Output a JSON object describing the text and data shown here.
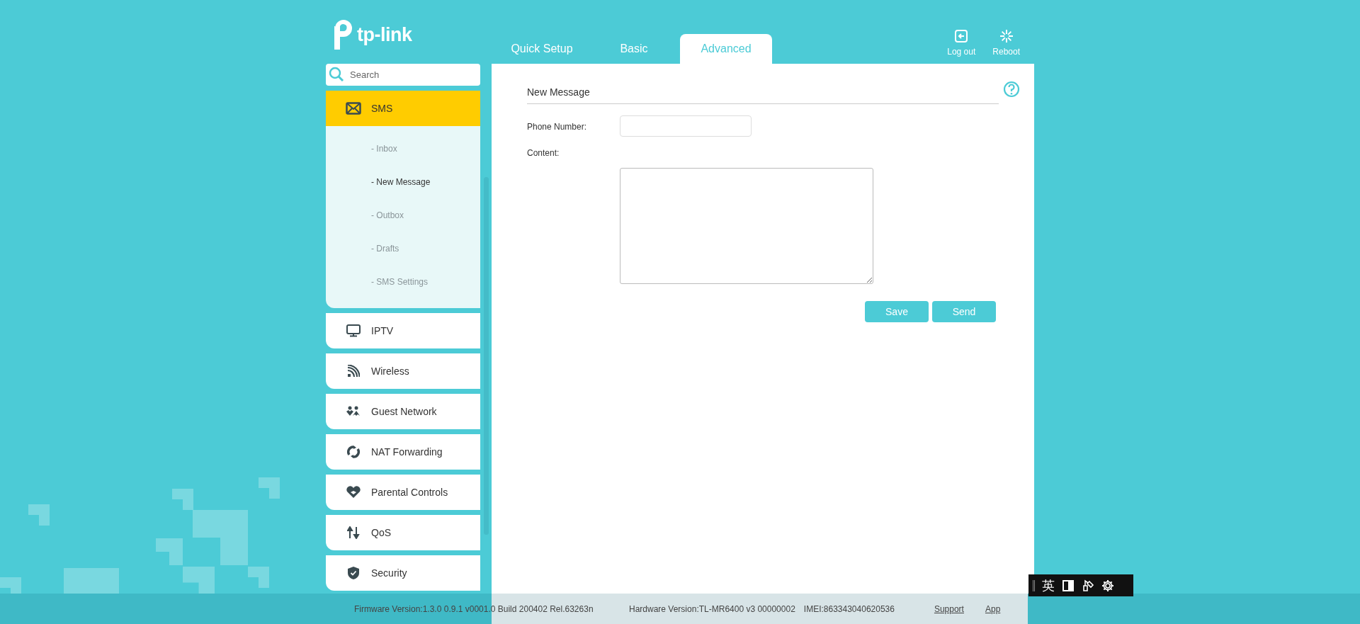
{
  "logo": {
    "text": "tp-link"
  },
  "tabs": [
    {
      "label": "Quick Setup",
      "selected": false
    },
    {
      "label": "Basic",
      "selected": false
    },
    {
      "label": "Advanced",
      "selected": true
    }
  ],
  "header_actions": [
    {
      "label": "Log out"
    },
    {
      "label": "Reboot"
    }
  ],
  "sidebar": {
    "search": {
      "placeholder": "Search"
    },
    "items": [
      {
        "label": "SMS",
        "selected": true,
        "expanded": true,
        "children": [
          {
            "label": "- Inbox",
            "selected": false
          },
          {
            "label": "- New Message",
            "selected": true
          },
          {
            "label": "- Outbox",
            "selected": false
          },
          {
            "label": "- Drafts",
            "selected": false
          },
          {
            "label": "- SMS Settings",
            "selected": false
          }
        ]
      },
      {
        "label": "IPTV",
        "selected": false
      },
      {
        "label": "Wireless",
        "selected": false
      },
      {
        "label": "Guest Network",
        "selected": false
      },
      {
        "label": "NAT Forwarding",
        "selected": false
      },
      {
        "label": "Parental Controls",
        "selected": false
      },
      {
        "label": "QoS",
        "selected": false
      },
      {
        "label": "Security",
        "selected": false
      }
    ]
  },
  "form": {
    "title": "New Message",
    "fields": [
      {
        "label": "Phone Number:",
        "kind": "text"
      },
      {
        "label": "Content:",
        "kind": "textarea"
      }
    ],
    "buttons": [
      "Save",
      "Send"
    ]
  },
  "footer": {
    "firmware": "Firmware Version:1.3.0 0.9.1 v0001.0 Build 200402 Rel.63263n",
    "hardware": "Hardware Version:TL-MR6400 v3 00000002",
    "imei": "IMEI:863343040620536",
    "links": [
      "Support",
      "App"
    ]
  },
  "ime_toolbar": {
    "language": "英"
  }
}
